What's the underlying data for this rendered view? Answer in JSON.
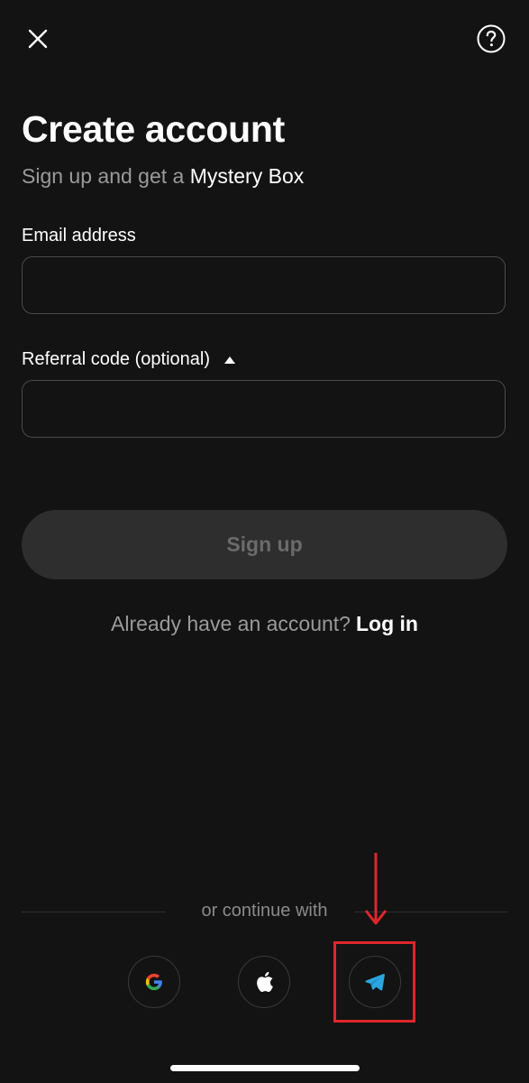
{
  "header": {
    "close_icon": "close-icon",
    "help_icon": "help-icon"
  },
  "title": "Create account",
  "subtitle": {
    "prefix": "Sign up and get a",
    "highlight": "Mystery Box"
  },
  "email": {
    "label": "Email address",
    "value": "",
    "placeholder": ""
  },
  "referral": {
    "label": "Referral code (optional)",
    "value": "",
    "placeholder": ""
  },
  "signup_button": {
    "label": "Sign up"
  },
  "login": {
    "prompt": "Already have an account?",
    "link": "Log in"
  },
  "social": {
    "divider_text": "or continue with",
    "providers": [
      {
        "name": "google-icon"
      },
      {
        "name": "apple-icon"
      },
      {
        "name": "telegram-icon"
      }
    ]
  },
  "colors": {
    "background": "#131313",
    "annotation_red": "#e0262b",
    "telegram_blue": "#2aa6e0"
  }
}
